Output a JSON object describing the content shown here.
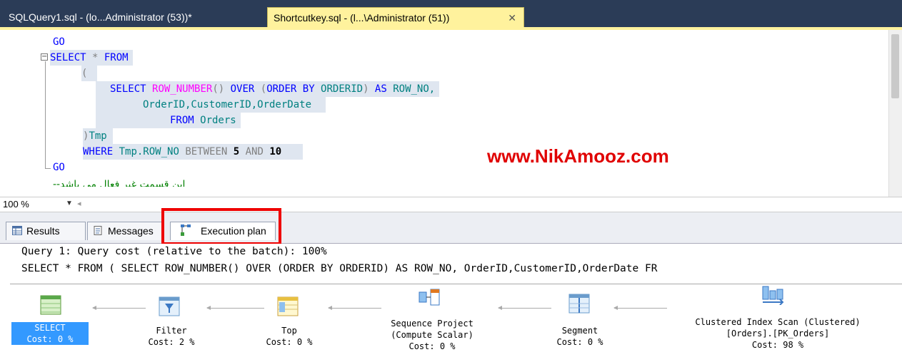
{
  "tabs": [
    {
      "label": "SQLQuery1.sql - (lo...Administrator (53))*",
      "active": false
    },
    {
      "label": "Shortcutkey.sql - (l...\\Administrator (51))",
      "active": true,
      "close": "✕"
    }
  ],
  "editor": {
    "lines": {
      "go1": "GO",
      "select_kw": "SELECT",
      "star": " * ",
      "from_kw": "FROM",
      "open_paren": "(",
      "sel2_select": "SELECT ",
      "row_number": "ROW_NUMBER",
      "paren_over": "() ",
      "over_kw": "OVER",
      "paren_open2": " (",
      "order_by": "ORDER BY",
      "orderid_up": " ORDERID",
      "paren_close_as": ") ",
      "as_kw": "AS",
      "row_no": " ROW_NO,",
      "cols": "OrderID,CustomerID,OrderDate",
      "from_kw2": "FROM",
      "orders": " Orders",
      "close_tmp": ")",
      "tmp": "Tmp",
      "where_kw": "WHERE",
      "tmp_rowno": " Tmp.ROW_NO ",
      "between": "BETWEEN",
      "five": " 5 ",
      "and_kw": "AND",
      "ten": " 10",
      "go2": "GO",
      "comment": "--این قسمت غیر فعال می باشد"
    },
    "watermark": "www.NikAmooz.com"
  },
  "zoom": {
    "value": "100 %"
  },
  "result_tabs": [
    {
      "label": "Results"
    },
    {
      "label": "Messages"
    },
    {
      "label": "Execution plan",
      "selected": true
    }
  ],
  "plan": {
    "query_header": "Query 1: Query cost (relative to the batch): 100%",
    "query_text": "SELECT * FROM ( SELECT ROW_NUMBER() OVER (ORDER BY ORDERID) AS ROW_NO, OrderID,CustomerID,OrderDate FR",
    "operators": [
      {
        "name": "SELECT",
        "cost": "Cost: 0 %",
        "selected": true
      },
      {
        "name": "Filter",
        "cost": "Cost: 2 %"
      },
      {
        "name": "Top",
        "cost": "Cost: 0 %"
      },
      {
        "name": "Sequence Project",
        "detail": "(Compute Scalar)",
        "cost": "Cost: 0 %"
      },
      {
        "name": "Segment",
        "cost": "Cost: 0 %"
      },
      {
        "name": "Clustered Index Scan (Clustered)",
        "detail": "[Orders].[PK_Orders]",
        "cost": "Cost: 98 %"
      }
    ]
  },
  "colors": {
    "keyword": "#0000ff",
    "function": "#ff00ff",
    "identifier": "#008080",
    "comment": "#008000",
    "watermark": "#e00000",
    "highlight_box": "#ee0000"
  }
}
